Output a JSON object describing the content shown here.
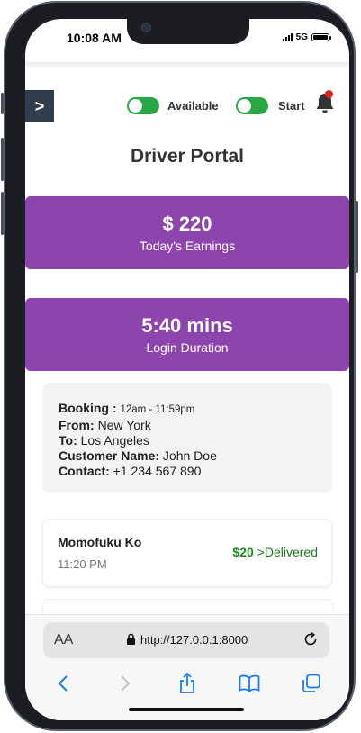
{
  "status_bar": {
    "time": "10:08 AM",
    "network": "5G"
  },
  "header": {
    "menu_label": ">",
    "available_label": "Available",
    "start_label": "Start",
    "available_on": true,
    "start_on": true
  },
  "page_title": "Driver Portal",
  "earnings": {
    "value": "$ 220",
    "label": "Today's Earnings"
  },
  "login": {
    "value": "5:40 mins",
    "label": "Login Duration"
  },
  "booking": {
    "booking_label": "Booking :",
    "booking_time": "12am - 11:59pm",
    "from_label": "From:",
    "from_value": "New York",
    "to_label": "To:",
    "to_value": "Los Angeles",
    "customer_label": "Customer Name:",
    "customer_value": "John Doe",
    "contact_label": "Contact:",
    "contact_value": "+1 234 567 890"
  },
  "orders": [
    {
      "name": "Momofuku Ko",
      "time": "11:20 PM",
      "amount": "$20",
      "separator": ">",
      "status": "Delivered"
    }
  ],
  "browser": {
    "text_size": "AA",
    "url": "http://127.0.0.1:8000"
  },
  "colors": {
    "accent": "#8e44ad",
    "toggle_on": "#27a844",
    "menu_button": "#2f3d4e",
    "delivered": "#1e7a1e",
    "notification_dot": "#e0211b",
    "ios_blue": "#1a7cf4"
  }
}
